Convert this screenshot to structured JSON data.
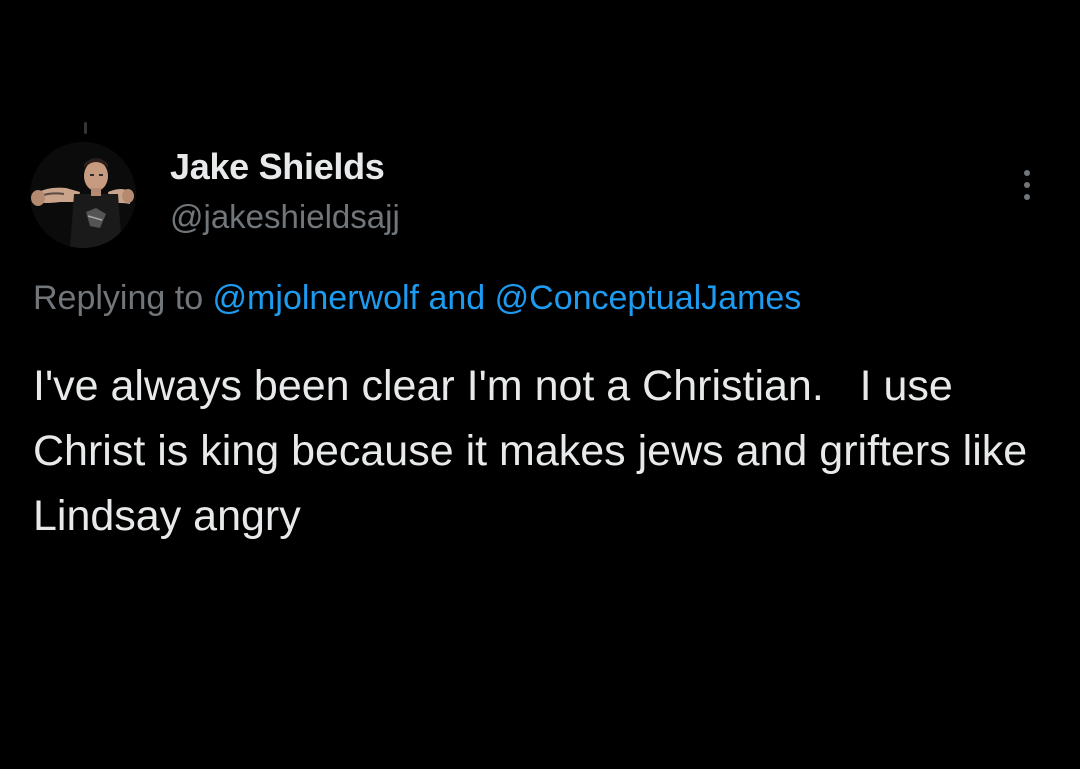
{
  "author": {
    "name": "Jake Shields",
    "handle": "@jakeshieldsajj"
  },
  "reply": {
    "prefix": "Replying to ",
    "mention_1": "@mjolnerwolf",
    "conjunction": " and ",
    "mention_2": "@ConceptualJames"
  },
  "tweet": {
    "text": "I've always been clear I'm not a Christian.   I use Christ is king because it makes jews and grifters like Lindsay angry"
  },
  "icons": {
    "more": "more-vertical-icon",
    "avatar": "profile-photo"
  },
  "colors": {
    "background": "#000000",
    "primary_text": "#e7e9ea",
    "secondary_text": "#71767b",
    "link": "#1d9bf0"
  }
}
